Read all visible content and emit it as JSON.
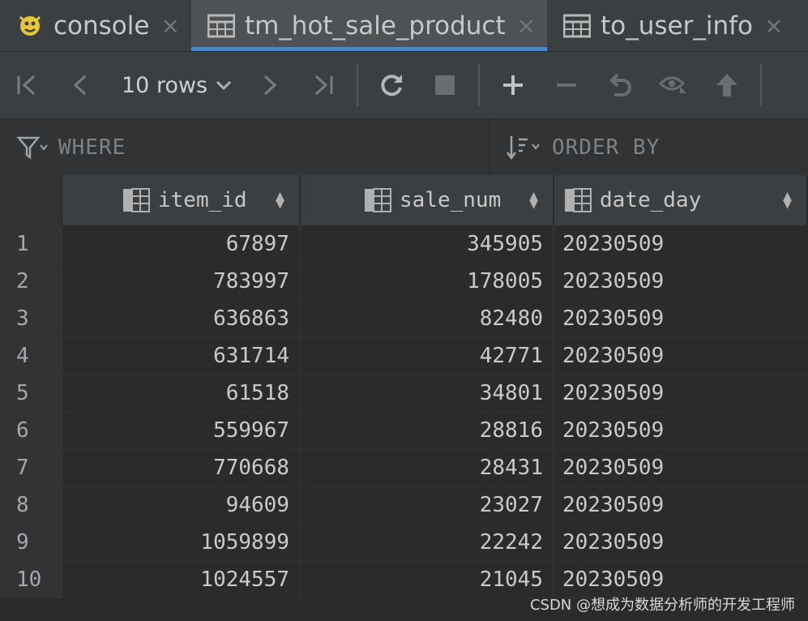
{
  "tabs": [
    {
      "label": "console",
      "icon": "console-icon",
      "active": false
    },
    {
      "label": "tm_hot_sale_product",
      "icon": "table-icon",
      "active": true
    },
    {
      "label": "to_user_info",
      "icon": "table-icon",
      "active": false
    }
  ],
  "toolbar": {
    "rows_label": "10 rows"
  },
  "filters": {
    "where_label": "WHERE",
    "orderby_label": "ORDER BY"
  },
  "grid": {
    "columns": [
      "item_id",
      "sale_num",
      "date_day"
    ],
    "rows": [
      {
        "n": "1",
        "item_id": "67897",
        "sale_num": "345905",
        "date_day": "20230509"
      },
      {
        "n": "2",
        "item_id": "783997",
        "sale_num": "178005",
        "date_day": "20230509"
      },
      {
        "n": "3",
        "item_id": "636863",
        "sale_num": "82480",
        "date_day": "20230509"
      },
      {
        "n": "4",
        "item_id": "631714",
        "sale_num": "42771",
        "date_day": "20230509"
      },
      {
        "n": "5",
        "item_id": "61518",
        "sale_num": "34801",
        "date_day": "20230509"
      },
      {
        "n": "6",
        "item_id": "559967",
        "sale_num": "28816",
        "date_day": "20230509"
      },
      {
        "n": "7",
        "item_id": "770668",
        "sale_num": "28431",
        "date_day": "20230509"
      },
      {
        "n": "8",
        "item_id": "94609",
        "sale_num": "23027",
        "date_day": "20230509"
      },
      {
        "n": "9",
        "item_id": "1059899",
        "sale_num": "22242",
        "date_day": "20230509"
      },
      {
        "n": "10",
        "item_id": "1024557",
        "sale_num": "21045",
        "date_day": "20230509"
      }
    ]
  },
  "watermark": "CSDN @想成为数据分析师的开发工程师",
  "colors": {
    "accent": "#4a88c7",
    "background": "#2b2b2b",
    "panel": "#3c3f41"
  }
}
